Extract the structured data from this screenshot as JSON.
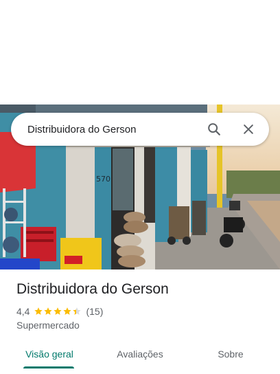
{
  "search": {
    "query": "Distribuidora do Gerson",
    "search_icon": "search-icon",
    "clear_icon": "close-icon"
  },
  "place": {
    "name": "Distribuidora do Gerson",
    "rating": "4,4",
    "stars_value": 4.4,
    "review_count": "(15)",
    "category": "Supermercado"
  },
  "tabs": [
    {
      "label": "Visão geral",
      "active": true
    },
    {
      "label": "Avaliações",
      "active": false
    },
    {
      "label": "Sobre",
      "active": false
    }
  ],
  "colors": {
    "accent": "#00796b",
    "star": "#fbbc04",
    "star_empty": "#dadce0"
  }
}
